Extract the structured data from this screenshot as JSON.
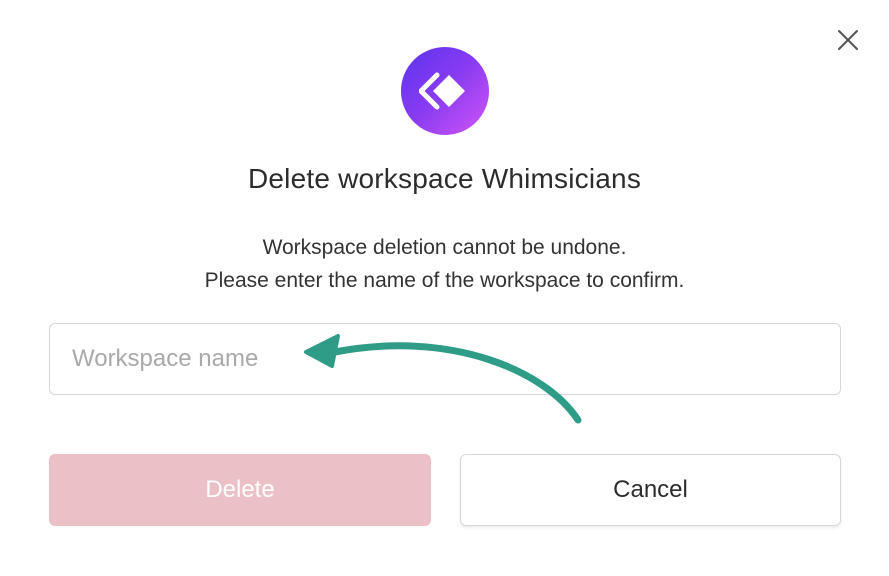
{
  "dialog": {
    "title": "Delete workspace Whimsicians",
    "description_line1": "Workspace deletion cannot be undone.",
    "description_line2": "Please enter the name of the workspace to confirm.",
    "input": {
      "placeholder": "Workspace name",
      "value": ""
    },
    "delete_label": "Delete",
    "cancel_label": "Cancel",
    "close_icon": "close-icon",
    "logo_icon": "workspace-logo-icon",
    "annotation_icon": "curved-arrow-icon"
  },
  "colors": {
    "logo_gradient_start": "#5b33f0",
    "logo_gradient_end": "#d455f7",
    "delete_disabled_bg": "#ebc0c6",
    "annotation_arrow": "#2e9c86",
    "title_text": "#2c2c2c"
  }
}
